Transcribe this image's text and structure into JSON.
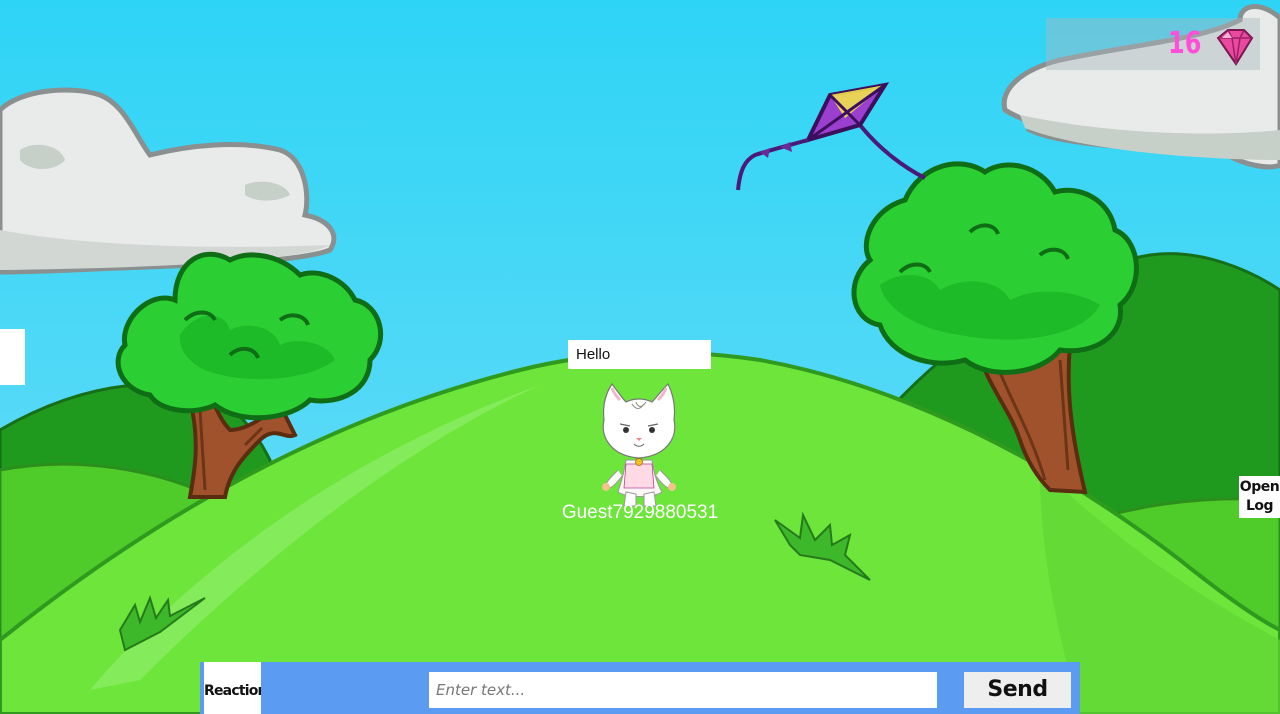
{
  "hud": {
    "gem_count": "16",
    "gem_icon": "gem-icon",
    "gem_color": "#e83e8c",
    "open_log_label": "Open Log"
  },
  "scene": {
    "sky_color": "#3fd2f5",
    "hill_color": "#6ee33a",
    "tree_color": "#22c22a",
    "kite_color": "#8a2fb8"
  },
  "player": {
    "name": "Guest7929880531",
    "speech": "Hello"
  },
  "chat": {
    "reaction_label": "Reaction",
    "input_placeholder": "Enter text...",
    "input_value": "",
    "send_label": "Send",
    "bar_color": "#5b9bf2"
  }
}
